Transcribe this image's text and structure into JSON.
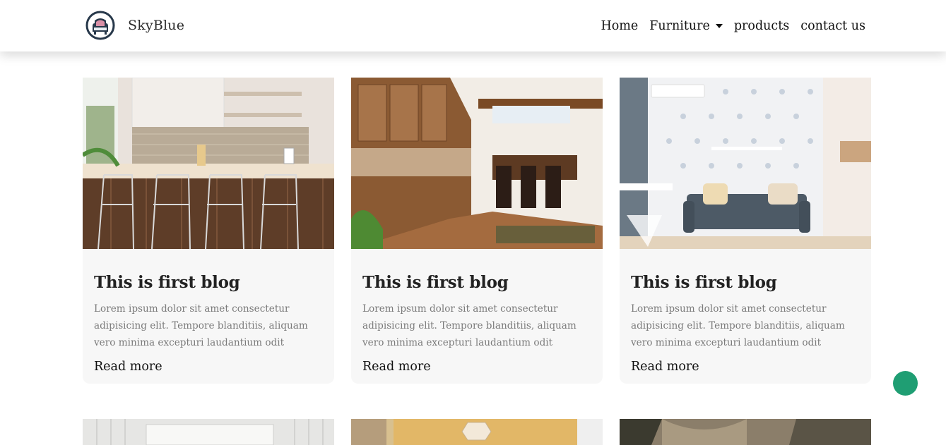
{
  "brand": {
    "name": "SkyBlue",
    "logo_icon": "armchair-logo-icon"
  },
  "nav": {
    "links": [
      {
        "label": "Home"
      },
      {
        "label": "Furniture",
        "has_dropdown": true
      },
      {
        "label": "products"
      },
      {
        "label": "contact us"
      }
    ]
  },
  "cards": [
    {
      "image": "kitchen-bar-stools-image",
      "title": "This is first blog",
      "text": "Lorem ipsum dolor sit amet consectetur adipisicing elit. Tempore blanditiis, aliquam vero minima excepturi laudantium odit",
      "link": "Read more"
    },
    {
      "image": "wood-kitchen-island-image",
      "title": "This is first blog",
      "text": "Lorem ipsum dolor sit amet consectetur adipisicing elit. Tempore blanditiis, aliquam vero minima excepturi laudantium odit",
      "link": "Read more"
    },
    {
      "image": "living-room-sofa-image",
      "title": "This is first blog",
      "text": "Lorem ipsum dolor sit amet consectetur adipisicing elit. Tempore blanditiis, aliquam vero minima excepturi laudantium odit",
      "link": "Read more"
    }
  ],
  "colors": {
    "fab": "#1f9e73",
    "card_bg": "#f7f7f7",
    "text_muted": "#7b7b7b"
  },
  "floating_button": {
    "icon": "circle-button-icon"
  }
}
